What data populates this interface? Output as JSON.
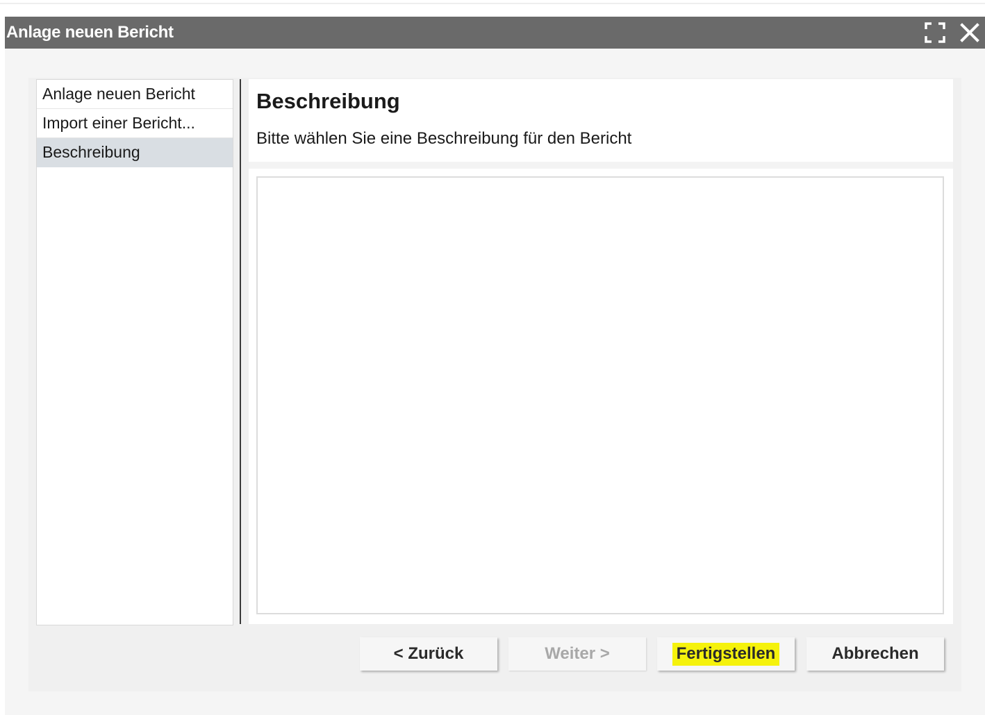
{
  "window": {
    "title": "Anlage neuen Bericht",
    "maximize_icon": "maximize-icon",
    "close_icon": "close-icon"
  },
  "sidebar": {
    "items": [
      {
        "label": "Anlage neuen Bericht",
        "active": false
      },
      {
        "label": "Import einer Bericht...",
        "active": false
      },
      {
        "label": "Beschreibung",
        "active": true
      }
    ]
  },
  "main": {
    "title": "Beschreibung",
    "subtitle": "Bitte wählen Sie eine Beschreibung für den Bericht",
    "description_value": ""
  },
  "footer": {
    "back_label": "< Zurück",
    "next_label": "Weiter >",
    "next_disabled": true,
    "finish_label": "Fertigstellen",
    "finish_highlighted": true,
    "cancel_label": "Abbrechen"
  },
  "colors": {
    "titlebar": "#6a6a6a",
    "active_nav": "#d9dee3",
    "highlight": "#f5f20c"
  }
}
